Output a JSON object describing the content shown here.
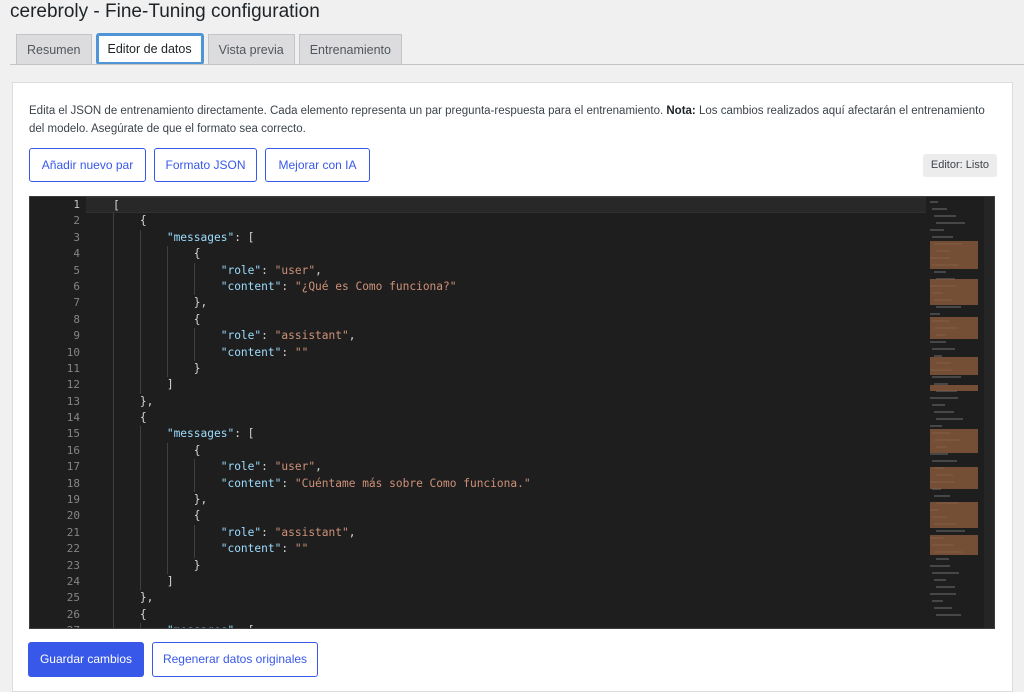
{
  "header": {
    "title": "cerebroly - Fine-Tuning configuration"
  },
  "tabs": [
    {
      "label": "Resumen",
      "active": false
    },
    {
      "label": "Editor de datos",
      "active": true
    },
    {
      "label": "Vista previa",
      "active": false
    },
    {
      "label": "Entrenamiento",
      "active": false
    }
  ],
  "description": {
    "text": "Edita el JSON de entrenamiento directamente. Cada elemento representa un par pregunta-respuesta para el entrenamiento.",
    "note_label": "Nota:",
    "note_text": "Los cambios realizados aquí afectarán el entrenamiento del modelo. Asegúrate de que el formato sea correcto."
  },
  "toolbar": {
    "add_pair_label": "Añadir nuevo par",
    "format_json_label": "Formato JSON",
    "improve_ai_label": "Mejorar con IA",
    "status": "Editor: Listo"
  },
  "editor": {
    "current_line": 1,
    "lines": [
      "[",
      "    {",
      "        \"messages\": [",
      "            {",
      "                \"role\": \"user\",",
      "                \"content\": \"¿Qué es Como funciona?\"",
      "            },",
      "            {",
      "                \"role\": \"assistant\",",
      "                \"content\": \"\"",
      "            }",
      "        ]",
      "    },",
      "    {",
      "        \"messages\": [",
      "            {",
      "                \"role\": \"user\",",
      "                \"content\": \"Cuéntame más sobre Como funciona.\"",
      "            },",
      "            {",
      "                \"role\": \"assistant\",",
      "                \"content\": \"\"",
      "            }",
      "        ]",
      "    },",
      "    {",
      "        \"messages\": ["
    ]
  },
  "footer": {
    "save_label": "Guardar cambios",
    "regenerate_label": "Regenerar datos originales"
  },
  "colors": {
    "accent": "#3858e9",
    "editor_bg": "#1e1e1e",
    "json_key": "#9cdcfe",
    "json_string": "#ce9178"
  }
}
